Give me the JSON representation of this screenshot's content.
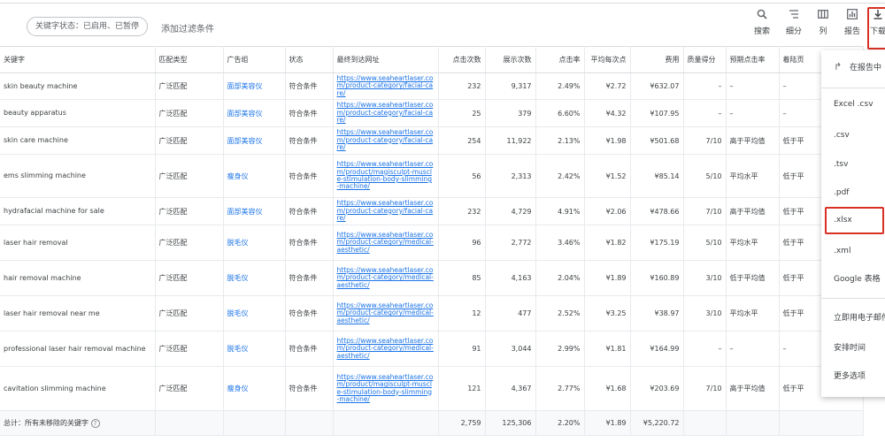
{
  "filter_bar": {
    "status_chip": "关键字状态：已启用、已暂停",
    "add_filter": "添加过滤条件"
  },
  "toolbar": {
    "search": "搜索",
    "segment": "细分",
    "columns": "列",
    "reports": "报告",
    "download": "下载"
  },
  "table": {
    "headers": [
      "关键字",
      "匹配类型",
      "广告组",
      "状态",
      "最终到达网址",
      "点击次数",
      "展示次数",
      "点击率",
      "平均每次点",
      "费用",
      "质量得分",
      "预期点击率",
      "着陆页"
    ],
    "rows": [
      {
        "keyword": "skin beauty machine",
        "match": "广泛匹配",
        "group": "面部美容仪",
        "status": "符合条件",
        "url": "https://www.seaheartlaser.com/product-category/facial-care/",
        "clicks": "232",
        "impr": "9,317",
        "ctr": "2.49%",
        "cpc": "¥2.72",
        "cost": "¥632.07",
        "qs": "–",
        "exp_ctr": "–",
        "landing": "–"
      },
      {
        "keyword": "beauty apparatus",
        "match": "广泛匹配",
        "group": "面部美容仪",
        "status": "符合条件",
        "url": "https://www.seaheartlaser.com/product-category/facial-care/",
        "clicks": "25",
        "impr": "379",
        "ctr": "6.60%",
        "cpc": "¥4.32",
        "cost": "¥107.95",
        "qs": "–",
        "exp_ctr": "–",
        "landing": "–"
      },
      {
        "keyword": "skin care machine",
        "match": "广泛匹配",
        "group": "面部美容仪",
        "status": "符合条件",
        "url": "https://www.seaheartlaser.com/product-category/facial-care/",
        "clicks": "254",
        "impr": "11,922",
        "ctr": "2.13%",
        "cpc": "¥1.98",
        "cost": "¥501.68",
        "qs": "7/10",
        "exp_ctr": "高于平均值",
        "landing": "低于平"
      },
      {
        "keyword": "ems slimming machine",
        "match": "广泛匹配",
        "group": "瘦身仪",
        "status": "符合条件",
        "url": "https://www.seaheartlaser.com/product/magisculpt-muscle-stimulation-body-slimming-machine/",
        "clicks": "56",
        "impr": "2,313",
        "ctr": "2.42%",
        "cpc": "¥1.52",
        "cost": "¥85.14",
        "qs": "5/10",
        "exp_ctr": "平均水平",
        "landing": "低于平"
      },
      {
        "keyword": "hydrafacial machine for sale",
        "match": "广泛匹配",
        "group": "面部美容仪",
        "status": "符合条件",
        "url": "https://www.seaheartlaser.com/product-category/facial-care/",
        "clicks": "232",
        "impr": "4,729",
        "ctr": "4.91%",
        "cpc": "¥2.06",
        "cost": "¥478.66",
        "qs": "7/10",
        "exp_ctr": "高于平均值",
        "landing": "低于平"
      },
      {
        "keyword": "laser hair removal",
        "match": "广泛匹配",
        "group": "脱毛仪",
        "status": "符合条件",
        "url": "https://www.seaheartlaser.com/product-category/medical-aesthetic/",
        "clicks": "96",
        "impr": "2,772",
        "ctr": "3.46%",
        "cpc": "¥1.82",
        "cost": "¥175.19",
        "qs": "5/10",
        "exp_ctr": "平均水平",
        "landing": "低于平"
      },
      {
        "keyword": "hair removal machine",
        "match": "广泛匹配",
        "group": "脱毛仪",
        "status": "符合条件",
        "url": "https://www.seaheartlaser.com/product-category/medical-aesthetic/",
        "clicks": "85",
        "impr": "4,163",
        "ctr": "2.04%",
        "cpc": "¥1.89",
        "cost": "¥160.89",
        "qs": "3/10",
        "exp_ctr": "低于平均值",
        "landing": "低于平"
      },
      {
        "keyword": "laser hair removal near me",
        "match": "广泛匹配",
        "group": "脱毛仪",
        "status": "符合条件",
        "url": "https://www.seaheartlaser.com/product-category/medical-aesthetic/",
        "clicks": "12",
        "impr": "477",
        "ctr": "2.52%",
        "cpc": "¥3.25",
        "cost": "¥38.97",
        "qs": "3/10",
        "exp_ctr": "平均水平",
        "landing": "低于平"
      },
      {
        "keyword": "professional laser hair removal machine",
        "match": "广泛匹配",
        "group": "脱毛仪",
        "status": "符合条件",
        "url": "https://www.seaheartlaser.com/product-category/medical-aesthetic/",
        "clicks": "91",
        "impr": "3,044",
        "ctr": "2.99%",
        "cpc": "¥1.81",
        "cost": "¥164.99",
        "qs": "–",
        "exp_ctr": "–",
        "landing": "–"
      },
      {
        "keyword": "cavitation slimming machine",
        "match": "广泛匹配",
        "group": "瘦身仪",
        "status": "符合条件",
        "url": "https://www.seaheartlaser.com/product/magisculpt-muscle-stimulation-body-slimming-machine/",
        "clicks": "121",
        "impr": "4,367",
        "ctr": "2.77%",
        "cpc": "¥1.68",
        "cost": "¥203.69",
        "qs": "7/10",
        "exp_ctr": "高于平均值",
        "landing": "低于平"
      }
    ],
    "total": {
      "label": "总计：所有未移除的关键字",
      "clicks": "2,759",
      "impr": "125,306",
      "ctr": "2.20%",
      "cpc": "¥1.89",
      "cost": "¥5,220.72"
    }
  },
  "download_menu": {
    "share": "在报告中",
    "items": [
      "Excel .csv",
      ".csv",
      ".tsv",
      ".pdf",
      ".xlsx",
      ".xml",
      "Google 表格"
    ],
    "email": "立即用电子邮件",
    "schedule": "安排时间",
    "more": "更多选项"
  },
  "colors": {
    "link": "#1a73e8",
    "highlight": "#d93025"
  }
}
